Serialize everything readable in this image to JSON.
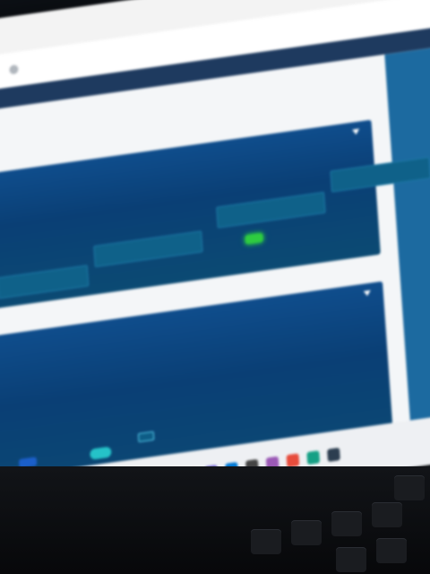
{
  "browser": {
    "tab_title": "",
    "address": "",
    "bookmarks": [
      "",
      "",
      "",
      "",
      ""
    ]
  },
  "panel1": {
    "title": "",
    "fields": [
      {
        "label": ""
      },
      {
        "label": ""
      },
      {
        "label": ""
      },
      {
        "label": ""
      }
    ],
    "primary_button": ""
  },
  "panel2": {
    "title": "",
    "columns": [
      "",
      "",
      "",
      "",
      ""
    ],
    "buttons": {
      "blue": "",
      "green": "",
      "cyan": "",
      "outline": ""
    }
  },
  "taskbar_icons": [
    "#8b5a2b",
    "#f2b41c",
    "#e05b2a",
    "#3a8ee6",
    "#2a6fd6",
    "#d9342b",
    "#2aa198",
    "#1aa1e6",
    "#ffb900",
    "#6a5acd",
    "#0078d4",
    "#444444",
    "#9b59b6",
    "#e74c3c",
    "#16a085",
    "#2c3e50"
  ],
  "colors": {
    "accent": "#0f4d8c",
    "success": "#2ecc40",
    "cyan": "#25c2c8"
  }
}
